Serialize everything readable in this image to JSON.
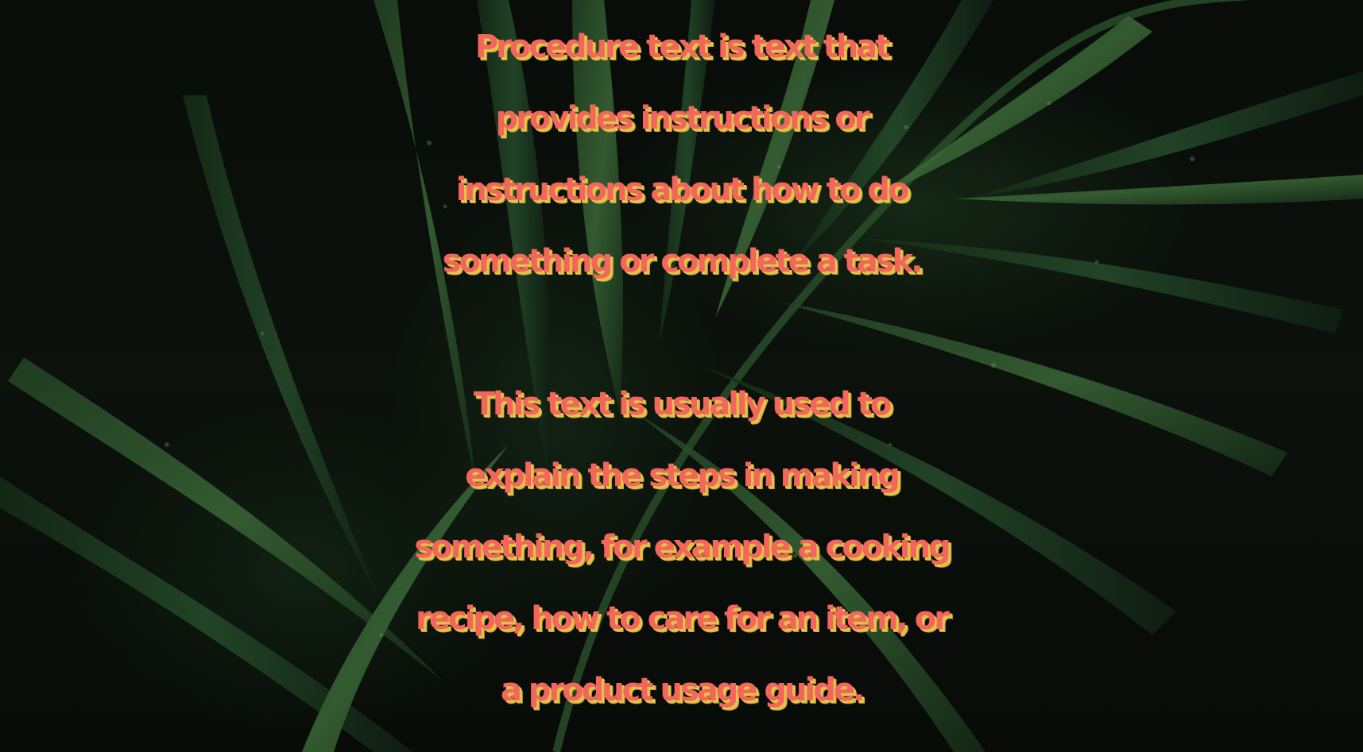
{
  "background": {
    "image": "green-palm-leaves-with-water-droplets",
    "colors": {
      "base": "#0d120e",
      "leaf_dark": "#1c3a1f",
      "leaf_mid": "#2e5a30",
      "leaf_light": "#4f8a4a"
    }
  },
  "text_style": {
    "fill_color": "#f2665c",
    "shadow_color": "#e4c24a"
  },
  "paragraphs": [
    {
      "lines": [
        "Procedure text is text that",
        "provides instructions or",
        "instructions about how to do",
        "something or complete a task."
      ]
    },
    {
      "lines": [
        "This text is usually used to",
        "explain the steps in making",
        "something, for example a cooking",
        "recipe, how to care for an item, or",
        "a product usage guide."
      ]
    }
  ]
}
